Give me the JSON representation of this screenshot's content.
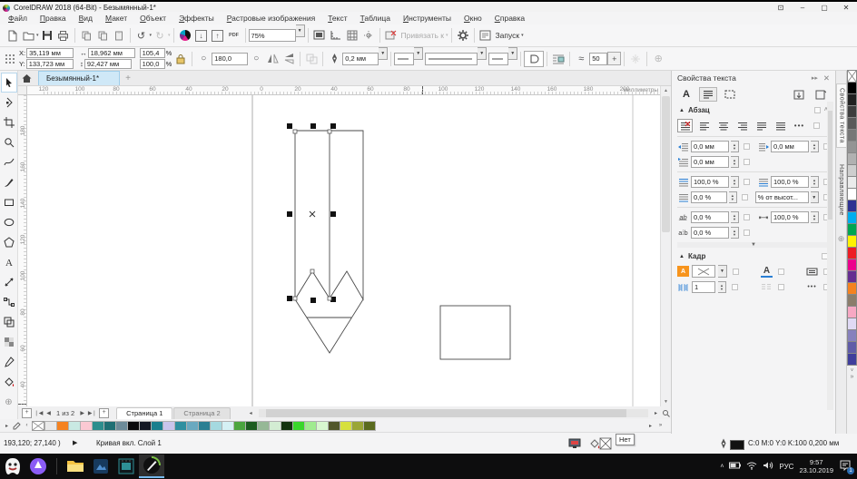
{
  "titlebar": {
    "title": "CorelDRAW 2018 (64-Bit) - Безымянный-1*"
  },
  "menubar": [
    "Файл",
    "Правка",
    "Вид",
    "Макет",
    "Объект",
    "Эффекты",
    "Растровые изображения",
    "Текст",
    "Таблица",
    "Инструменты",
    "Окно",
    "Справка"
  ],
  "toolbar": {
    "zoom_value": "75%",
    "pdf_label": "PDF",
    "snap_label": "Привязать к",
    "launch_label": "Запуск"
  },
  "propertybar": {
    "x_label": "X:",
    "x_value": "35,119 мм",
    "y_label": "Y:",
    "y_value": "133,723 мм",
    "width_value": "18,962 мм",
    "height_value": "92,427 мм",
    "scale_x": "105,4",
    "scale_y": "100,0",
    "percent": "%",
    "rotation_value": "180,0",
    "outline_width": "0,2 мм",
    "smooth_value": "50"
  },
  "document": {
    "tab_title": "Безымянный-1*",
    "ruler_unit": "миллиметры",
    "h_ruler_numbers": [
      "120",
      "100",
      "80",
      "60",
      "40",
      "20",
      "0",
      "20",
      "40",
      "60",
      "80",
      "100",
      "120",
      "140",
      "160",
      "180",
      "200"
    ],
    "v_ruler_numbers": [
      "180",
      "160",
      "140",
      "120",
      "100",
      "80",
      "60",
      "40"
    ]
  },
  "docker": {
    "title": "Свойства текста",
    "section_paragraph": "Абзац",
    "section_frame": "Кадр",
    "indent_left": "0,0 мм",
    "indent_right": "0,0 мм",
    "indent_first": "0,0 мм",
    "v_space_before": "100,0 %",
    "v_space_after": "100,0 %",
    "line_spacing": "0,0 %",
    "spacing_mode": "% от высот...",
    "char_spacing": "0,0 %",
    "word_spacing": "100,0 %",
    "range_kerning": "0,0 %",
    "columns_value": "1",
    "vertical_tabs": [
      "Свойства текста",
      "Направляющие"
    ]
  },
  "pages": {
    "nav_text": "1 из 2",
    "tabs": [
      {
        "label": "Страница 1",
        "active": true
      },
      {
        "label": "Страница 2",
        "active": false
      }
    ]
  },
  "statusbar": {
    "coords": "193,120; 27,140 )",
    "object_info": "Кривая вкл. Слой 1",
    "fill_tooltip": "Нет",
    "outline_color_info": "C:0 M:0 Y:0 K:100  0,200 мм"
  },
  "taskbar": {
    "language": "РУС",
    "time": "9:57",
    "date": "23.10.2019",
    "notification_badge": "1"
  },
  "palette_main": [
    "#000000",
    "#202020",
    "#3d3d3d",
    "#5a5a5a",
    "#777777",
    "#949494",
    "#b1b1b1",
    "#cecece",
    "#ebebeb",
    "#ffffff",
    "#2e3192",
    "#00aeef",
    "#00a651",
    "#fff200",
    "#ed1c24",
    "#ec008c",
    "#662d91",
    "#f58220",
    "#8b7d6b",
    "#f7a8c3",
    "#e0daf5",
    "#8781bd",
    "#605ca8",
    "#403e9c"
  ],
  "palette_document": [
    "#e9e9e9",
    "#f58220",
    "#c9e9e3",
    "#fbc9d3",
    "#2d8d8d",
    "#1f6f74",
    "#6d8b99",
    "#0b0b0d",
    "#141824",
    "#1a7f8e",
    "#c9c5ec",
    "#2f8fa0",
    "#6aa9c0",
    "#2b7f93",
    "#a5d9e0",
    "#d5f0f4",
    "#4ba53f",
    "#1d5c20",
    "#96b896",
    "#d3ecd3",
    "#13330f",
    "#39d62b",
    "#a0eb8f",
    "#d8f7cf",
    "#51562a",
    "#d6e03d",
    "#9aa636",
    "#5a6b1f"
  ],
  "toolbox_tools": [
    "pick-tool",
    "shape-tool",
    "crop-tool",
    "zoom-tool",
    "freehand-tool",
    "artistic-media-tool",
    "rectangle-tool",
    "ellipse-tool",
    "polygon-tool",
    "text-tool",
    "dimension-tool",
    "connector-tool",
    "contour-tool",
    "transparency-tool",
    "eyedropper-tool",
    "interactive-fill-tool"
  ]
}
